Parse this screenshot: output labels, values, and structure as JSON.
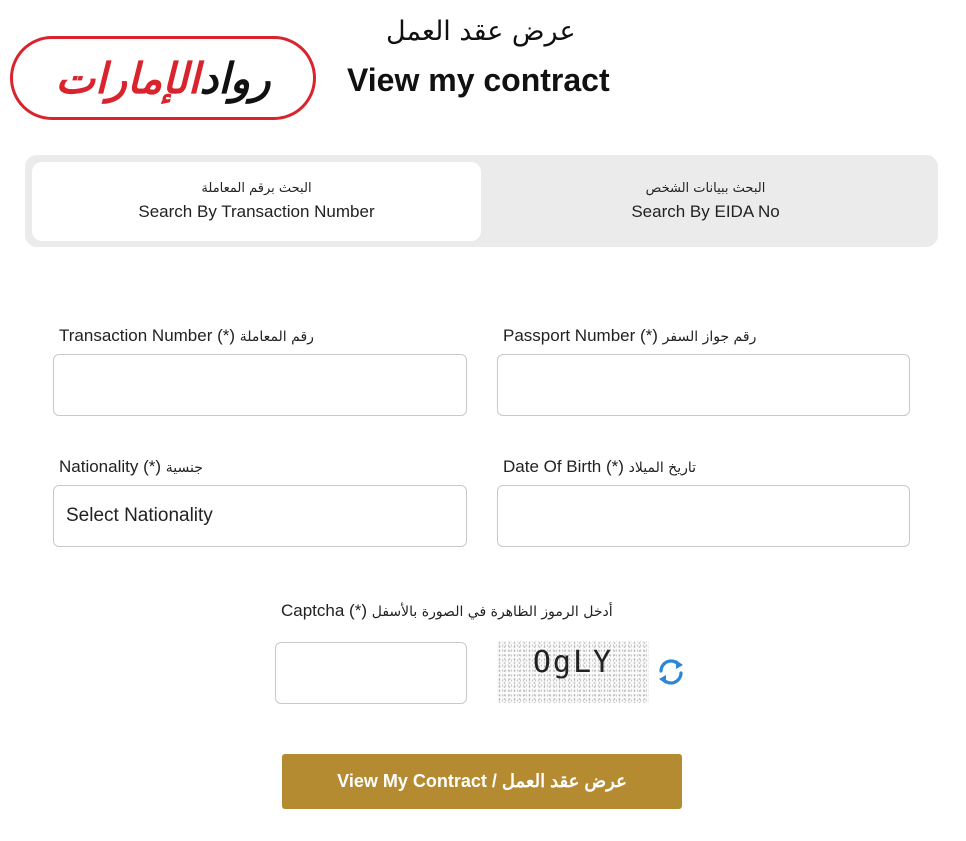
{
  "header": {
    "logo_text_black": "رواد",
    "logo_text_red": "الإمارات",
    "title_ar": "عرض عقد العمل",
    "title_en": "View my contract"
  },
  "tabs": [
    {
      "label_ar": "البحث برقم المعاملة",
      "label_en": "Search By Transaction Number",
      "active": true
    },
    {
      "label_ar": "البحث ببيانات الشخص",
      "label_en": "Search By EIDA No",
      "active": false
    }
  ],
  "form": {
    "transaction_label": "Transaction Number (*)",
    "transaction_label_ar": "رقم المعاملة",
    "transaction_value": "",
    "passport_label": "Passport Number (*)",
    "passport_label_ar": "رقم جواز السفر",
    "passport_value": "",
    "nationality_label": "Nationality (*)",
    "nationality_label_ar": "جنسية",
    "nationality_selected": "Select Nationality",
    "dob_label": "Date Of Birth (*)",
    "dob_label_ar": "تاريخ الميلاد",
    "dob_value": "",
    "captcha_label": "Captcha (*)",
    "captcha_label_ar": "أدخل الرموز الظاهرة في الصورة بالأسفل",
    "captcha_value": "",
    "captcha_text": "OgLY",
    "submit_label": "View My Contract / عرض عقد العمل"
  },
  "colors": {
    "brand_red": "#d9232d",
    "button_gold": "#b48b30",
    "refresh_blue": "#2e86d6",
    "tab_bg": "#ebebeb"
  },
  "icons": {
    "refresh": "refresh-icon"
  }
}
